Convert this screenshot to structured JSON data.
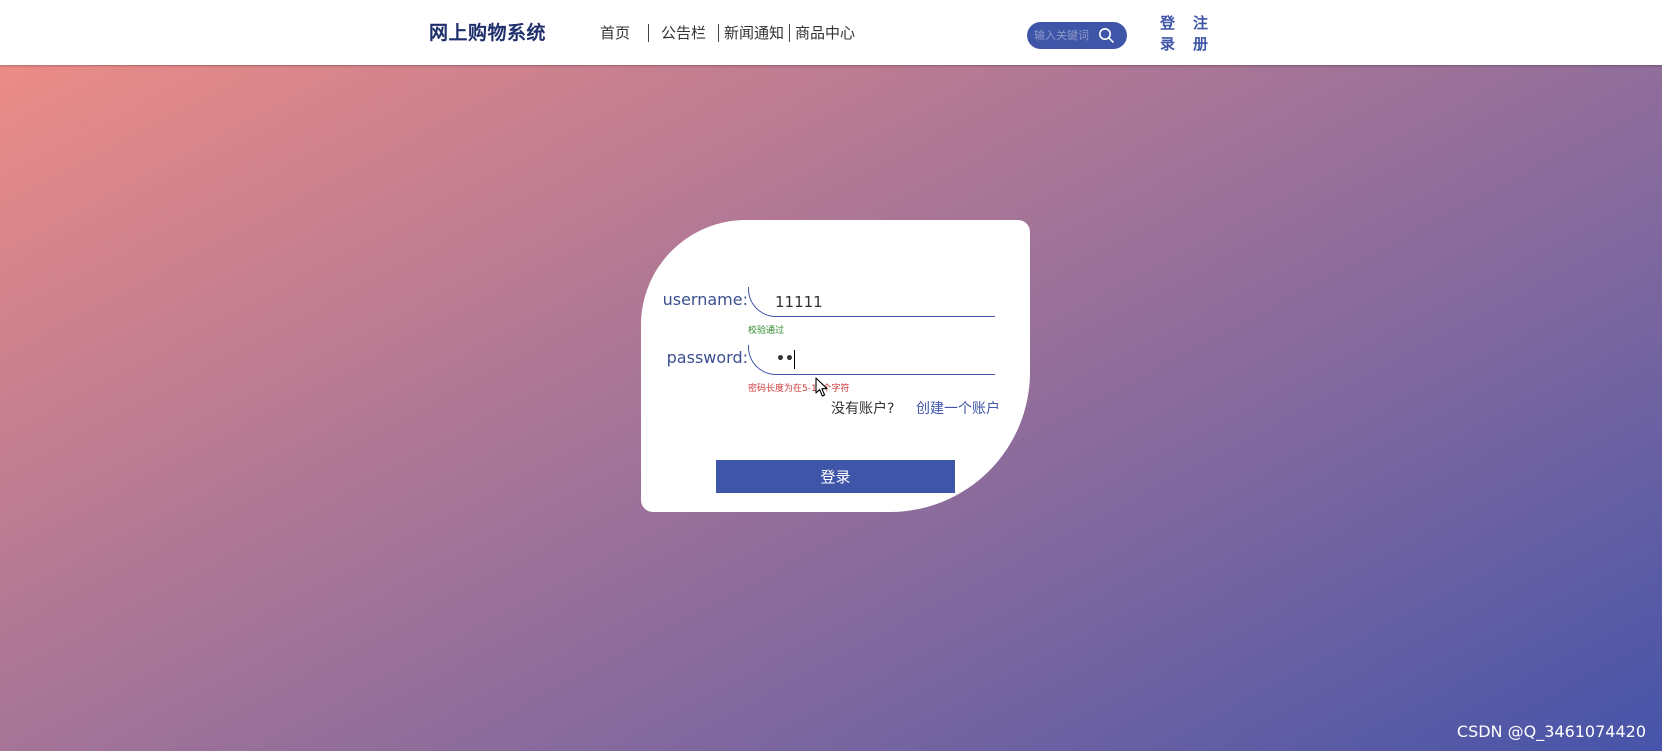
{
  "header": {
    "brand": "网上购物系统",
    "nav": [
      "首页",
      "公告栏",
      "新闻通知",
      "商品中心"
    ],
    "search": {
      "placeholder": "输入关键词",
      "icon": "search-icon"
    },
    "login": "登录",
    "register": "注册"
  },
  "login_form": {
    "username_label": "username:",
    "username_value": "11111",
    "username_hint": "校验通过",
    "password_label": "password:",
    "password_display": "••",
    "password_hint": "密码长度为在5-10个字符",
    "no_account": "没有账户?",
    "create_account": "创建一个账户",
    "submit": "登录"
  },
  "watermark": "CSDN @Q_3461074420",
  "colors": {
    "primary": "#3f55a8",
    "brand_text": "#1f2f6b",
    "hint_ok": "#2e8a2e",
    "hint_err": "#d03b3b",
    "gradient_start": "#f28e85",
    "gradient_end": "#4654a9"
  }
}
